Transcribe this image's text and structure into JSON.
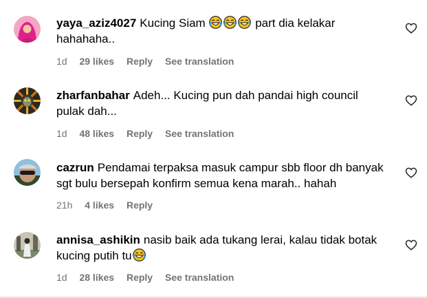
{
  "comments": [
    {
      "username": "yaya_aziz4027",
      "text_a": "Kucing Siam",
      "emoji_a": "😂😂😂",
      "text_b": "part dia kelakar hahahaha..",
      "time": "1d",
      "likes": "29 likes",
      "reply": "Reply",
      "translation": "See translation"
    },
    {
      "username": "zharfanbahar",
      "text_a": "Adeh... Kucing pun dah pandai high council pulak dah...",
      "time": "1d",
      "likes": "48 likes",
      "reply": "Reply",
      "translation": "See translation"
    },
    {
      "username": "cazrun",
      "text_a": "Pendamai terpaksa masuk campur sbb floor dh banyak sgt bulu bersepah konfirm semua kena marah.. hahah",
      "time": "21h",
      "likes": "4 likes",
      "reply": "Reply"
    },
    {
      "username": "annisa_ashikin",
      "text_a": "nasib baik ada tukang lerai, kalau tidak botak kucing putih tu",
      "emoji_a": "😂",
      "time": "1d",
      "likes": "28 likes",
      "reply": "Reply",
      "translation": "See translation"
    }
  ],
  "colors": {
    "text": "#000000",
    "meta": "#737373",
    "heart_stroke": "#262626"
  },
  "icons": {
    "like": "heart-outline-icon",
    "emoji": "face-with-tears-of-joy-emoji"
  }
}
